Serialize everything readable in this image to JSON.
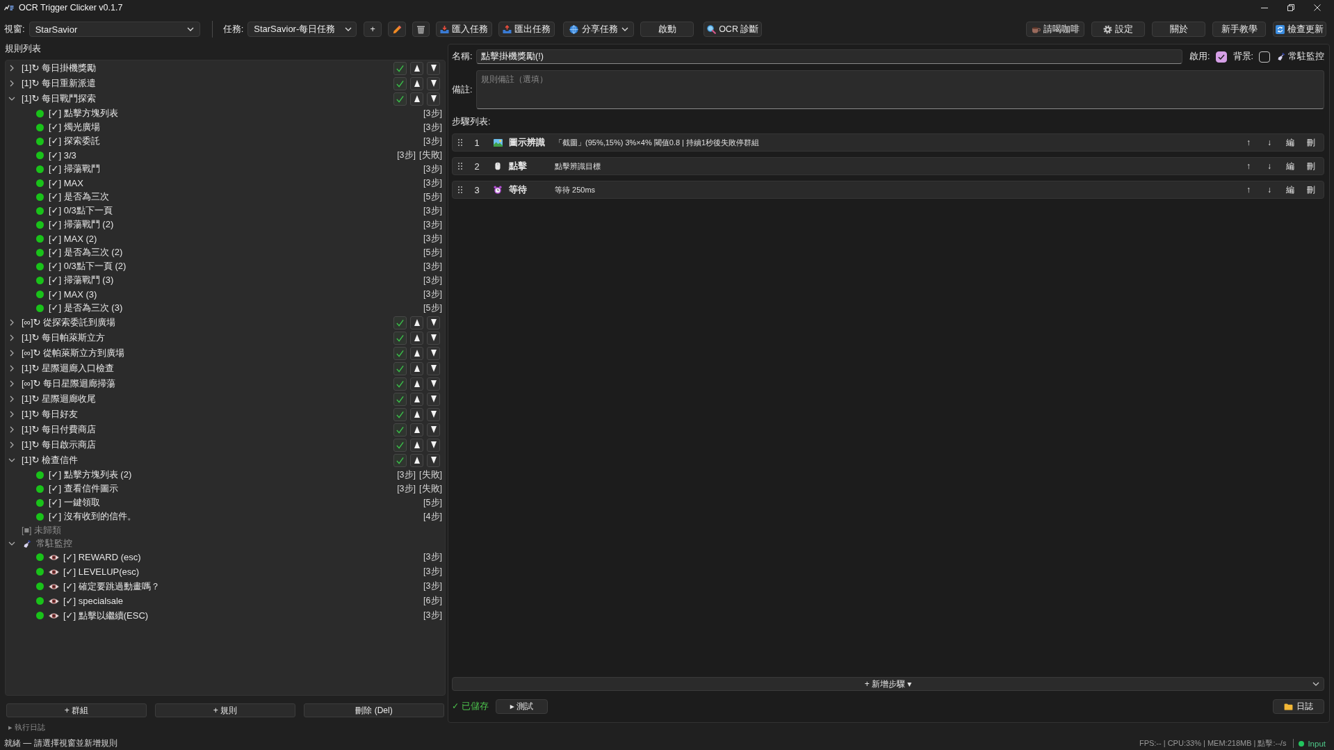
{
  "window": {
    "title": "OCR Trigger Clicker v0.1.7"
  },
  "toolbar": {
    "window_select": {
      "label": "視窗:",
      "value": "StarSavior"
    },
    "task_select": {
      "label": "任務:",
      "value": "StarSavior-每日任務"
    },
    "task_buttons": [
      {
        "kind": "add",
        "label": "+"
      },
      {
        "kind": "edit"
      },
      {
        "kind": "delete"
      },
      {
        "kind": "import",
        "label": "匯入任務"
      },
      {
        "kind": "export",
        "label": "匯出任務"
      },
      {
        "kind": "share",
        "label": "分享任務"
      },
      {
        "kind": "start",
        "label": "啟動"
      },
      {
        "kind": "ocr",
        "label": "OCR 診斷"
      }
    ],
    "app_buttons": [
      {
        "kind": "coffee",
        "label": "請喝咖啡"
      },
      {
        "kind": "settings",
        "label": "設定"
      },
      {
        "kind": "about",
        "label": "關於"
      },
      {
        "kind": "tutorial",
        "label": "新手教學"
      },
      {
        "kind": "update",
        "label": "檢查更新"
      }
    ]
  },
  "rules": {
    "title": "規則列表",
    "groups": [
      {
        "kind": "group",
        "prefix": "[1]↻",
        "name": "每日掛機獎勵",
        "expanded": false,
        "enabled": true
      },
      {
        "kind": "group",
        "prefix": "[1]↻",
        "name": "每日重新派遣",
        "expanded": false,
        "enabled": true
      },
      {
        "kind": "group",
        "prefix": "[1]↻",
        "name": "每日戰鬥探索",
        "expanded": true,
        "enabled": true,
        "children": [
          {
            "label": "[✓] 點擊方塊列表",
            "steps": "[3步]"
          },
          {
            "label": "[✓] 燭光廣場",
            "steps": "[3步]"
          },
          {
            "label": "[✓] 探索委託",
            "steps": "[3步]"
          },
          {
            "label": "[✓] 3/3",
            "steps": "[3步]",
            "status": "[失敗]"
          },
          {
            "label": "[✓] 掃蕩戰鬥",
            "steps": "[3步]"
          },
          {
            "label": "[✓] MAX",
            "steps": "[3步]"
          },
          {
            "label": "[✓] 是否為三次",
            "steps": "[5步]"
          },
          {
            "label": "[✓] 0/3點下一頁",
            "steps": "[3步]"
          },
          {
            "label": "[✓] 掃蕩戰鬥 (2)",
            "steps": "[3步]"
          },
          {
            "label": "[✓] MAX (2)",
            "steps": "[3步]"
          },
          {
            "label": "[✓] 是否為三次 (2)",
            "steps": "[5步]"
          },
          {
            "label": "[✓] 0/3點下一頁 (2)",
            "steps": "[3步]"
          },
          {
            "label": "[✓] 掃蕩戰鬥 (3)",
            "steps": "[3步]"
          },
          {
            "label": "[✓] MAX (3)",
            "steps": "[3步]"
          },
          {
            "label": "[✓] 是否為三次 (3)",
            "steps": "[5步]"
          }
        ]
      },
      {
        "kind": "group",
        "prefix": "[∞]↻",
        "name": "從探索委託到廣場",
        "expanded": false,
        "enabled": true
      },
      {
        "kind": "group",
        "prefix": "[1]↻",
        "name": "每日帕萊斯立方",
        "expanded": false,
        "enabled": true
      },
      {
        "kind": "group",
        "prefix": "[∞]↻",
        "name": "從帕萊斯立方到廣場",
        "expanded": false,
        "enabled": true
      },
      {
        "kind": "group",
        "prefix": "[1]↻",
        "name": "星際迴廊入口檢查",
        "expanded": false,
        "enabled": true
      },
      {
        "kind": "group",
        "prefix": "[∞]↻",
        "name": "每日星際迴廊掃蕩",
        "expanded": false,
        "enabled": true
      },
      {
        "kind": "group",
        "prefix": "[1]↻",
        "name": "星際迴廊收尾",
        "expanded": false,
        "enabled": true
      },
      {
        "kind": "group",
        "prefix": "[1]↻",
        "name": "每日好友",
        "expanded": false,
        "enabled": true
      },
      {
        "kind": "group",
        "prefix": "[1]↻",
        "name": "每日付費商店",
        "expanded": false,
        "enabled": true
      },
      {
        "kind": "group",
        "prefix": "[1]↻",
        "name": "每日啟示商店",
        "expanded": false,
        "enabled": true
      },
      {
        "kind": "group",
        "prefix": "[1]↻",
        "name": "檢查信件",
        "expanded": true,
        "enabled": true,
        "children": [
          {
            "label": "[✓] 點擊方塊列表 (2)",
            "steps": "[3步]",
            "status": "[失敗]"
          },
          {
            "label": "[✓] 查看信件圖示",
            "steps": "[3步]",
            "status": "[失敗]"
          },
          {
            "label": "[✓] 一鍵領取",
            "steps": "[5步]"
          },
          {
            "label": "[✓] 沒有收到的信件。",
            "steps": "[4步]"
          }
        ]
      },
      {
        "kind": "uncategorized",
        "label": "[■] 未歸類"
      },
      {
        "kind": "monitor",
        "name": "常駐監控",
        "expanded": true,
        "children": [
          {
            "label": "[✓] REWARD (esc)",
            "steps": "[3步]"
          },
          {
            "label": "[✓] LEVELUP(esc)",
            "steps": "[3步]"
          },
          {
            "label": "[✓] 確定要跳過動畫嗎？",
            "steps": "[3步]"
          },
          {
            "label": "[✓] specialsale",
            "steps": "[6步]"
          },
          {
            "label": "[✓] 點擊以繼續(ESC)",
            "steps": "[3步]"
          }
        ]
      }
    ],
    "buttons": [
      "+ 群組",
      "+ 規則",
      "刪除 (Del)"
    ],
    "log_toggle": "▸ 執行日誌"
  },
  "editor": {
    "name_field": {
      "label": "名稱:",
      "value": "點擊掛機獎勵(!)"
    },
    "enabled": {
      "label": "啟用:",
      "checked": true
    },
    "background": {
      "label": "背景:",
      "checked": false
    },
    "monitor": {
      "label": "常駐監控"
    },
    "note_field": {
      "label": "備註:",
      "placeholder": "規則備註（選填）"
    },
    "steps_title": "步驟列表:",
    "steps": [
      {
        "number": "1",
        "kind": "image",
        "type": "圖示辨識",
        "detail": "「截圖」(95%,15%) 3%×4% 閾值0.8 | 持續1秒後失敗停群組",
        "actions": [
          "↑",
          "↓",
          "編",
          "刪"
        ]
      },
      {
        "number": "2",
        "kind": "click",
        "type": "點擊",
        "detail": "點擊辨識目標",
        "actions": [
          "↑",
          "↓",
          "編",
          "刪"
        ]
      },
      {
        "number": "3",
        "kind": "wait",
        "type": "等待",
        "detail": "等待 250ms",
        "actions": [
          "↑",
          "↓",
          "編",
          "刪"
        ]
      }
    ],
    "add_step": "+ 新增步驟 ▾",
    "saved": "✓ 已儲存",
    "test_button": "▸ 測試",
    "log_button": "日誌"
  },
  "status_bar": {
    "message": "就緒 — 請選擇視窗並新增規則",
    "metrics": "FPS:-- | CPU:33% | MEM:218MB | 點擊:--/s",
    "input_label": "Input"
  }
}
